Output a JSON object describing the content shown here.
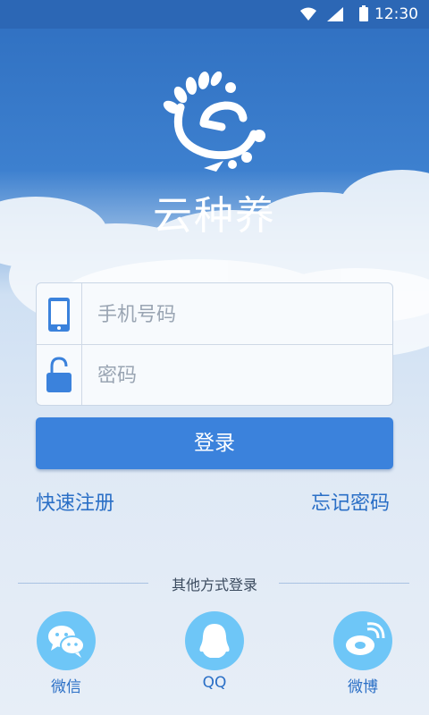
{
  "status_bar": {
    "time": "12:30"
  },
  "brand": {
    "name": "云种养"
  },
  "login_form": {
    "phone_placeholder": "手机号码",
    "password_placeholder": "密码"
  },
  "login_button": "登录",
  "links": {
    "register": "快速注册",
    "forgot_password": "忘记密码"
  },
  "other_login": {
    "divider_text": "其他方式登录",
    "options": [
      {
        "label": "微信",
        "icon": "wechat-icon"
      },
      {
        "label": "QQ",
        "icon": "qq-icon"
      },
      {
        "label": "微博",
        "icon": "weibo-icon"
      }
    ]
  },
  "colors": {
    "primary": "#3b82dc",
    "status_bar": "#2c67b5",
    "link": "#2a6fc6",
    "social": "#6ec6f7"
  }
}
